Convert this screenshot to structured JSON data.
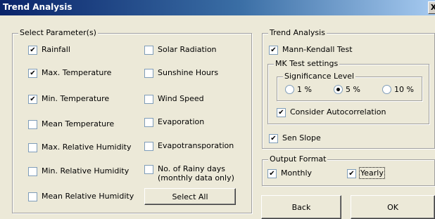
{
  "window": {
    "title": "Trend Analysis",
    "close": "X"
  },
  "params": {
    "legend": "Select Parameter(s)",
    "col1": [
      {
        "label": "Rainfall",
        "checked": true
      },
      {
        "label": "Max. Temperature",
        "checked": true
      },
      {
        "label": "Min. Temperature",
        "checked": true
      },
      {
        "label": "Mean Temperature",
        "checked": false
      },
      {
        "label": "Max. Relative Humidity",
        "checked": false
      },
      {
        "label": "Min. Relative Humidity",
        "checked": false
      },
      {
        "label": "Mean Relative Humidity",
        "checked": false
      }
    ],
    "col2": [
      {
        "label": "Solar Radiation",
        "checked": false
      },
      {
        "label": "Sunshine Hours",
        "checked": false
      },
      {
        "label": "Wind Speed",
        "checked": false
      },
      {
        "label": "Evaporation",
        "checked": false
      },
      {
        "label": "Evapotransporation",
        "checked": false
      },
      {
        "label": "No. of Rainy days\n(monthly data only)",
        "checked": false
      }
    ],
    "select_all": "Select All"
  },
  "trend": {
    "legend": "Trend Analysis",
    "mann_kendall": {
      "label": "Mann-Kendall Test",
      "checked": true
    },
    "mk_settings": {
      "legend": "MK Test settings",
      "significance": {
        "legend": "Significance Level",
        "options": [
          {
            "label": "1 %",
            "selected": false
          },
          {
            "label": "5 %",
            "selected": true
          },
          {
            "label": "10 %",
            "selected": false
          }
        ]
      },
      "autocorr": {
        "label": "Consider Autocorrelation",
        "checked": true
      }
    },
    "sen_slope": {
      "label": "Sen Slope",
      "checked": true
    }
  },
  "output": {
    "legend": "Output Format",
    "monthly": {
      "label": "Monthly",
      "checked": true
    },
    "yearly": {
      "label": "Yearly",
      "checked": true
    }
  },
  "buttons": {
    "back": "Back",
    "ok": "OK"
  }
}
